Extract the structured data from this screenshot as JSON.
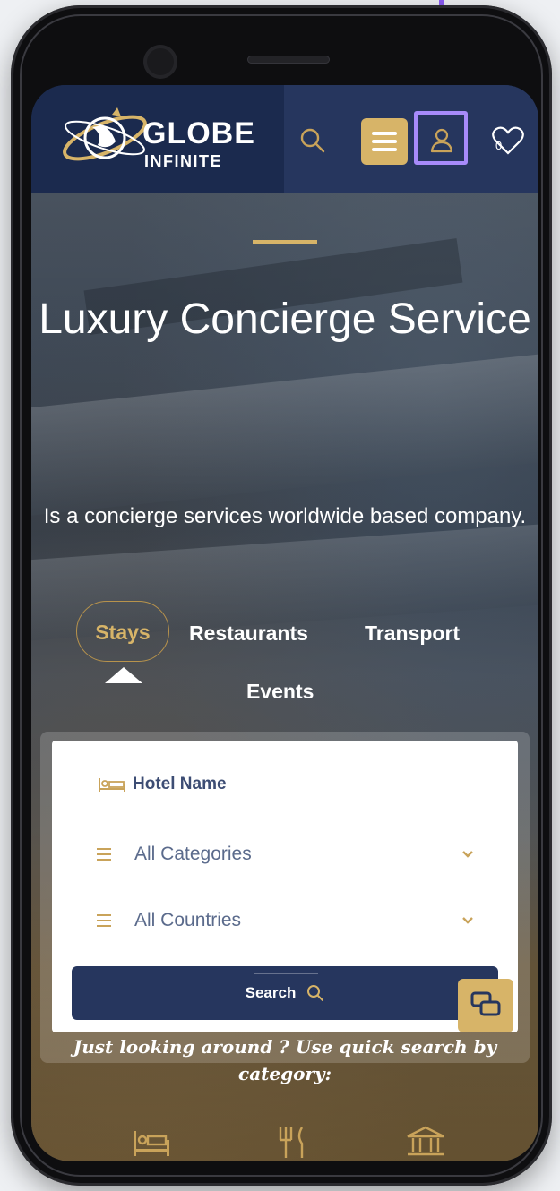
{
  "app": {
    "brand_line1": "GLOBE",
    "brand_line2": "INFINITE"
  },
  "header": {
    "icons": [
      "search-icon",
      "menu-icon",
      "user-icon",
      "heart-icon"
    ],
    "heart_count": "0",
    "menu_color": "#d7b468",
    "bg_color": "#1b2a4e"
  },
  "hero": {
    "title": "Luxury Concierge Service",
    "subtitle": "Is a concierge services worldwide based company.",
    "accent_color": "#d7b468"
  },
  "tabs": {
    "items": [
      {
        "label": "Stays",
        "active": true
      },
      {
        "label": "Restaurants",
        "active": false
      },
      {
        "label": "Transport",
        "active": false
      },
      {
        "label": "Events",
        "active": false
      }
    ]
  },
  "search_form": {
    "hotel_name_label": "Hotel Name",
    "category_select": "All Categories",
    "country_select": "All Countries",
    "search_button": "Search"
  },
  "quick_search": {
    "prompt": "Just looking around ? Use quick search by category:",
    "category_icons": [
      "bed-icon",
      "restaurant-icon",
      "landmark-icon"
    ]
  },
  "callout": {
    "target": "user-icon",
    "color": "#a78bfa"
  }
}
